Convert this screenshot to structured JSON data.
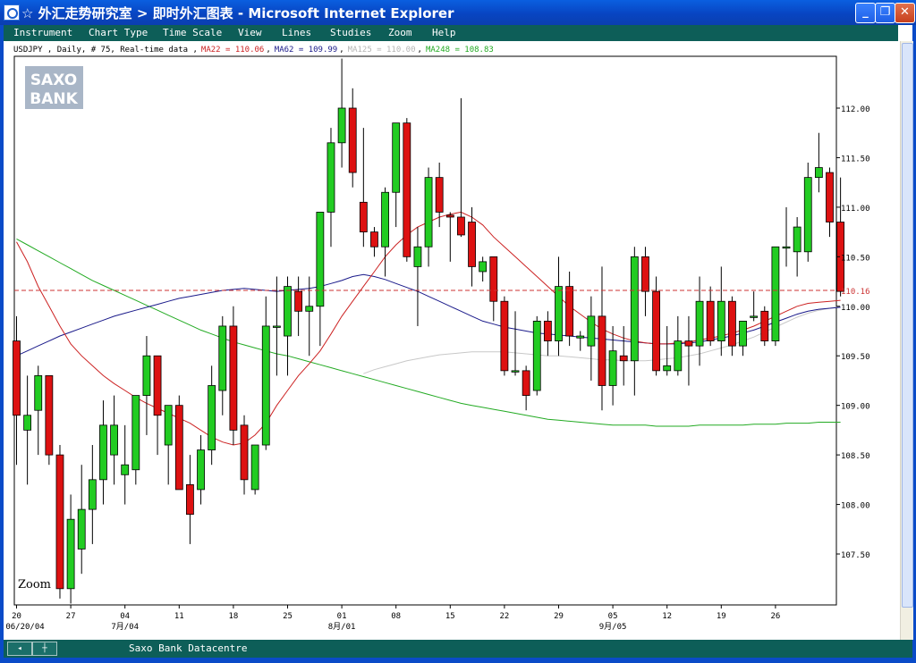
{
  "window": {
    "title": "☆ 外汇走势研究室 > 即时外汇图表 - Microsoft Internet Explorer",
    "min_label": "_",
    "max_label": "❐",
    "close_label": "✕"
  },
  "menu": [
    "Instrument",
    "Chart Type",
    "Time Scale",
    "View",
    "Lines",
    "Studies",
    "Zoom",
    "Help"
  ],
  "status": {
    "text": "Saxo Bank Datacentre"
  },
  "logo": {
    "line1": "SAXO",
    "line2": "BANK"
  },
  "colors": {
    "up": "#22cc22",
    "down": "#dd1111",
    "ma22": "#cc2222",
    "ma62": "#1a1a8a",
    "ma125": "#c8c8c8",
    "ma248": "#22aa22",
    "current": "#cc3333"
  },
  "chart_data": {
    "type": "candlestick",
    "header": {
      "prefix": "USDJPY , Daily, # 75, Real-time data ,",
      "ma22": "MA22 = 110.06",
      "ma62": "MA62 = 109.99",
      "ma125": "MA125 = 110.00",
      "ma248": "MA248 = 108.83"
    },
    "zoom_label": "Zoom",
    "current_price": 110.16,
    "current_price_label": "110.16",
    "ylim": [
      107.0,
      112.5
    ],
    "y_ticks": [
      {
        "value": 112.0,
        "label": "112.00"
      },
      {
        "value": 111.5,
        "label": "111.50"
      },
      {
        "value": 111.0,
        "label": "111.00"
      },
      {
        "value": 110.5,
        "label": "110.50"
      },
      {
        "value": 110.0,
        "label": "110.00"
      },
      {
        "value": 109.5,
        "label": "109.50"
      },
      {
        "value": 109.0,
        "label": "109.00"
      },
      {
        "value": 108.5,
        "label": "108.50"
      },
      {
        "value": 108.0,
        "label": "108.00"
      },
      {
        "value": 107.5,
        "label": "107.50"
      }
    ],
    "x_ticks": [
      {
        "index": 0,
        "day": "20",
        "sub": "06/20/04"
      },
      {
        "index": 5,
        "day": "27",
        "sub": ""
      },
      {
        "index": 10,
        "day": "04",
        "sub": "7月/04"
      },
      {
        "index": 15,
        "day": "11",
        "sub": ""
      },
      {
        "index": 20,
        "day": "18",
        "sub": ""
      },
      {
        "index": 25,
        "day": "25",
        "sub": ""
      },
      {
        "index": 30,
        "day": "01",
        "sub": "8月/01"
      },
      {
        "index": 35,
        "day": "08",
        "sub": ""
      },
      {
        "index": 40,
        "day": "15",
        "sub": ""
      },
      {
        "index": 45,
        "day": "22",
        "sub": ""
      },
      {
        "index": 50,
        "day": "29",
        "sub": ""
      },
      {
        "index": 55,
        "day": "05",
        "sub": "9月/05"
      },
      {
        "index": 60,
        "day": "12",
        "sub": ""
      },
      {
        "index": 65,
        "day": "19",
        "sub": ""
      },
      {
        "index": 70,
        "day": "26",
        "sub": ""
      }
    ],
    "candles": [
      {
        "o": 109.65,
        "h": 109.9,
        "l": 108.4,
        "c": 108.9
      },
      {
        "o": 108.75,
        "h": 109.3,
        "l": 108.2,
        "c": 108.9
      },
      {
        "o": 108.95,
        "h": 109.4,
        "l": 108.5,
        "c": 109.3
      },
      {
        "o": 109.3,
        "h": 109.3,
        "l": 108.4,
        "c": 108.5
      },
      {
        "o": 108.5,
        "h": 108.6,
        "l": 107.05,
        "c": 107.15
      },
      {
        "o": 107.15,
        "h": 108.1,
        "l": 107.0,
        "c": 107.85
      },
      {
        "o": 107.55,
        "h": 108.4,
        "l": 107.3,
        "c": 107.95
      },
      {
        "o": 107.95,
        "h": 108.6,
        "l": 107.6,
        "c": 108.25
      },
      {
        "o": 108.25,
        "h": 109.05,
        "l": 108.0,
        "c": 108.8
      },
      {
        "o": 108.5,
        "h": 109.1,
        "l": 108.2,
        "c": 108.8
      },
      {
        "o": 108.3,
        "h": 108.8,
        "l": 108.0,
        "c": 108.4
      },
      {
        "o": 108.35,
        "h": 109.1,
        "l": 108.2,
        "c": 109.1
      },
      {
        "o": 109.1,
        "h": 109.7,
        "l": 108.7,
        "c": 109.5
      },
      {
        "o": 109.5,
        "h": 109.5,
        "l": 108.5,
        "c": 108.9
      },
      {
        "o": 108.6,
        "h": 109.0,
        "l": 108.2,
        "c": 109.0
      },
      {
        "o": 109.0,
        "h": 109.1,
        "l": 108.2,
        "c": 108.15
      },
      {
        "o": 108.2,
        "h": 108.5,
        "l": 107.6,
        "c": 107.9
      },
      {
        "o": 108.15,
        "h": 108.7,
        "l": 108.0,
        "c": 108.55
      },
      {
        "o": 108.55,
        "h": 109.4,
        "l": 108.4,
        "c": 109.2
      },
      {
        "o": 109.15,
        "h": 109.9,
        "l": 108.9,
        "c": 109.8
      },
      {
        "o": 109.8,
        "h": 110.0,
        "l": 108.6,
        "c": 108.75
      },
      {
        "o": 108.8,
        "h": 108.9,
        "l": 108.1,
        "c": 108.25
      },
      {
        "o": 108.15,
        "h": 108.6,
        "l": 108.1,
        "c": 108.6
      },
      {
        "o": 108.6,
        "h": 110.1,
        "l": 108.55,
        "c": 109.8
      },
      {
        "o": 109.8,
        "h": 110.3,
        "l": 109.3,
        "c": 109.8
      },
      {
        "o": 109.7,
        "h": 110.3,
        "l": 109.3,
        "c": 110.2
      },
      {
        "o": 110.15,
        "h": 110.3,
        "l": 109.7,
        "c": 109.95
      },
      {
        "o": 109.95,
        "h": 110.3,
        "l": 109.5,
        "c": 110.0
      },
      {
        "o": 110.0,
        "h": 110.4,
        "l": 109.6,
        "c": 110.95
      },
      {
        "o": 110.95,
        "h": 111.8,
        "l": 110.6,
        "c": 111.65
      },
      {
        "o": 111.65,
        "h": 112.5,
        "l": 111.4,
        "c": 112.0
      },
      {
        "o": 112.0,
        "h": 112.2,
        "l": 111.2,
        "c": 111.35
      },
      {
        "o": 111.05,
        "h": 111.8,
        "l": 110.6,
        "c": 110.75
      },
      {
        "o": 110.75,
        "h": 110.8,
        "l": 110.5,
        "c": 110.6
      },
      {
        "o": 110.6,
        "h": 111.2,
        "l": 110.3,
        "c": 111.15
      },
      {
        "o": 111.15,
        "h": 111.85,
        "l": 110.8,
        "c": 111.85
      },
      {
        "o": 111.85,
        "h": 111.9,
        "l": 110.45,
        "c": 110.5
      },
      {
        "o": 110.4,
        "h": 110.8,
        "l": 109.8,
        "c": 110.6
      },
      {
        "o": 110.6,
        "h": 111.4,
        "l": 110.4,
        "c": 111.3
      },
      {
        "o": 111.3,
        "h": 111.45,
        "l": 110.8,
        "c": 110.95
      },
      {
        "o": 110.92,
        "h": 110.95,
        "l": 110.45,
        "c": 110.9
      },
      {
        "o": 110.9,
        "h": 112.1,
        "l": 110.7,
        "c": 110.72
      },
      {
        "o": 110.85,
        "h": 111.0,
        "l": 110.2,
        "c": 110.4
      },
      {
        "o": 110.35,
        "h": 110.5,
        "l": 110.25,
        "c": 110.45
      },
      {
        "o": 110.5,
        "h": 110.5,
        "l": 109.85,
        "c": 110.05
      },
      {
        "o": 110.05,
        "h": 110.1,
        "l": 109.3,
        "c": 109.35
      },
      {
        "o": 109.35,
        "h": 109.95,
        "l": 109.3,
        "c": 109.35
      },
      {
        "o": 109.35,
        "h": 109.4,
        "l": 108.95,
        "c": 109.1
      },
      {
        "o": 109.15,
        "h": 109.9,
        "l": 109.1,
        "c": 109.85
      },
      {
        "o": 109.85,
        "h": 109.95,
        "l": 109.5,
        "c": 109.65
      },
      {
        "o": 109.65,
        "h": 110.5,
        "l": 109.5,
        "c": 110.2
      },
      {
        "o": 110.2,
        "h": 110.35,
        "l": 109.6,
        "c": 109.7
      },
      {
        "o": 109.68,
        "h": 109.75,
        "l": 109.55,
        "c": 109.7
      },
      {
        "o": 109.6,
        "h": 110.1,
        "l": 109.25,
        "c": 109.9
      },
      {
        "o": 109.9,
        "h": 110.4,
        "l": 108.95,
        "c": 109.2
      },
      {
        "o": 109.2,
        "h": 109.8,
        "l": 109.0,
        "c": 109.55
      },
      {
        "o": 109.5,
        "h": 109.8,
        "l": 109.2,
        "c": 109.45
      },
      {
        "o": 109.45,
        "h": 110.6,
        "l": 109.1,
        "c": 110.5
      },
      {
        "o": 110.5,
        "h": 110.6,
        "l": 109.9,
        "c": 110.15
      },
      {
        "o": 110.15,
        "h": 110.3,
        "l": 109.3,
        "c": 109.35
      },
      {
        "o": 109.35,
        "h": 109.8,
        "l": 109.3,
        "c": 109.4
      },
      {
        "o": 109.35,
        "h": 109.9,
        "l": 109.3,
        "c": 109.65
      },
      {
        "o": 109.65,
        "h": 109.9,
        "l": 109.2,
        "c": 109.6
      },
      {
        "o": 109.6,
        "h": 110.3,
        "l": 109.4,
        "c": 110.05
      },
      {
        "o": 110.05,
        "h": 110.2,
        "l": 109.6,
        "c": 109.65
      },
      {
        "o": 109.65,
        "h": 110.4,
        "l": 109.5,
        "c": 110.05
      },
      {
        "o": 110.05,
        "h": 110.1,
        "l": 109.5,
        "c": 109.6
      },
      {
        "o": 109.6,
        "h": 109.85,
        "l": 109.5,
        "c": 109.85
      },
      {
        "o": 109.9,
        "h": 110.15,
        "l": 109.85,
        "c": 109.9
      },
      {
        "o": 109.95,
        "h": 110.0,
        "l": 109.6,
        "c": 109.65
      },
      {
        "o": 109.65,
        "h": 110.6,
        "l": 109.6,
        "c": 110.6
      },
      {
        "o": 110.6,
        "h": 111.0,
        "l": 110.4,
        "c": 110.6
      },
      {
        "o": 110.55,
        "h": 110.9,
        "l": 110.3,
        "c": 110.8
      },
      {
        "o": 110.55,
        "h": 111.45,
        "l": 110.45,
        "c": 111.3
      },
      {
        "o": 111.3,
        "h": 111.75,
        "l": 111.15,
        "c": 111.4
      },
      {
        "o": 111.35,
        "h": 111.4,
        "l": 110.7,
        "c": 110.85
      },
      {
        "o": 110.85,
        "h": 111.3,
        "l": 110.1,
        "c": 110.15
      }
    ],
    "ma22": [
      110.65,
      110.45,
      110.2,
      110.0,
      109.8,
      109.62,
      109.5,
      109.4,
      109.3,
      109.22,
      109.15,
      109.08,
      109.02,
      108.97,
      108.92,
      108.87,
      108.82,
      108.75,
      108.68,
      108.63,
      108.6,
      108.62,
      108.7,
      108.82,
      109.0,
      109.15,
      109.3,
      109.42,
      109.55,
      109.72,
      109.9,
      110.05,
      110.2,
      110.35,
      110.5,
      110.62,
      110.72,
      110.8,
      110.85,
      110.9,
      110.93,
      110.95,
      110.9,
      110.82,
      110.7,
      110.6,
      110.5,
      110.4,
      110.3,
      110.2,
      110.1,
      110.0,
      109.92,
      109.84,
      109.77,
      109.72,
      109.68,
      109.65,
      109.63,
      109.62,
      109.62,
      109.63,
      109.64,
      109.66,
      109.68,
      109.7,
      109.73,
      109.76,
      109.8,
      109.85,
      109.9,
      109.95,
      110.0,
      110.03,
      110.04,
      110.05,
      110.06
    ],
    "ma62": [
      109.5,
      109.55,
      109.6,
      109.65,
      109.7,
      109.74,
      109.78,
      109.82,
      109.86,
      109.9,
      109.93,
      109.96,
      109.99,
      110.02,
      110.05,
      110.08,
      110.1,
      110.12,
      110.14,
      110.16,
      110.17,
      110.18,
      110.17,
      110.16,
      110.15,
      110.16,
      110.17,
      110.18,
      110.2,
      110.23,
      110.26,
      110.3,
      110.32,
      110.3,
      110.27,
      110.23,
      110.19,
      110.15,
      110.1,
      110.05,
      110.0,
      109.95,
      109.9,
      109.85,
      109.82,
      109.79,
      109.77,
      109.75,
      109.73,
      109.72,
      109.71,
      109.7,
      109.69,
      109.68,
      109.67,
      109.66,
      109.65,
      109.64,
      109.63,
      109.62,
      109.62,
      109.62,
      109.63,
      109.64,
      109.66,
      109.68,
      109.7,
      109.73,
      109.76,
      109.8,
      109.84,
      109.88,
      109.92,
      109.95,
      109.97,
      109.98,
      109.99
    ],
    "ma125_start": 32,
    "ma125": [
      109.32,
      109.36,
      109.39,
      109.42,
      109.45,
      109.47,
      109.49,
      109.51,
      109.52,
      109.53,
      109.54,
      109.54,
      109.54,
      109.54,
      109.53,
      109.52,
      109.51,
      109.5,
      109.5,
      109.49,
      109.48,
      109.47,
      109.46,
      109.46,
      109.45,
      109.45,
      109.45,
      109.46,
      109.47,
      109.48,
      109.5,
      109.52,
      109.55,
      109.58,
      109.61,
      109.65,
      109.69,
      109.74,
      109.79,
      109.84,
      109.89,
      109.93,
      109.96,
      109.98,
      110.0
    ],
    "ma248": [
      110.68,
      110.62,
      110.56,
      110.5,
      110.44,
      110.38,
      110.32,
      110.26,
      110.21,
      110.16,
      110.11,
      110.06,
      110.01,
      109.96,
      109.91,
      109.86,
      109.81,
      109.76,
      109.72,
      109.68,
      109.64,
      109.61,
      109.58,
      109.55,
      109.52,
      109.5,
      109.47,
      109.44,
      109.41,
      109.38,
      109.35,
      109.32,
      109.29,
      109.26,
      109.23,
      109.2,
      109.17,
      109.14,
      109.11,
      109.08,
      109.05,
      109.02,
      109.0,
      108.98,
      108.96,
      108.94,
      108.92,
      108.9,
      108.88,
      108.86,
      108.85,
      108.84,
      108.83,
      108.82,
      108.81,
      108.8,
      108.8,
      108.8,
      108.8,
      108.79,
      108.79,
      108.79,
      108.79,
      108.8,
      108.8,
      108.8,
      108.8,
      108.8,
      108.81,
      108.81,
      108.81,
      108.82,
      108.82,
      108.82,
      108.83,
      108.83,
      108.83
    ]
  }
}
